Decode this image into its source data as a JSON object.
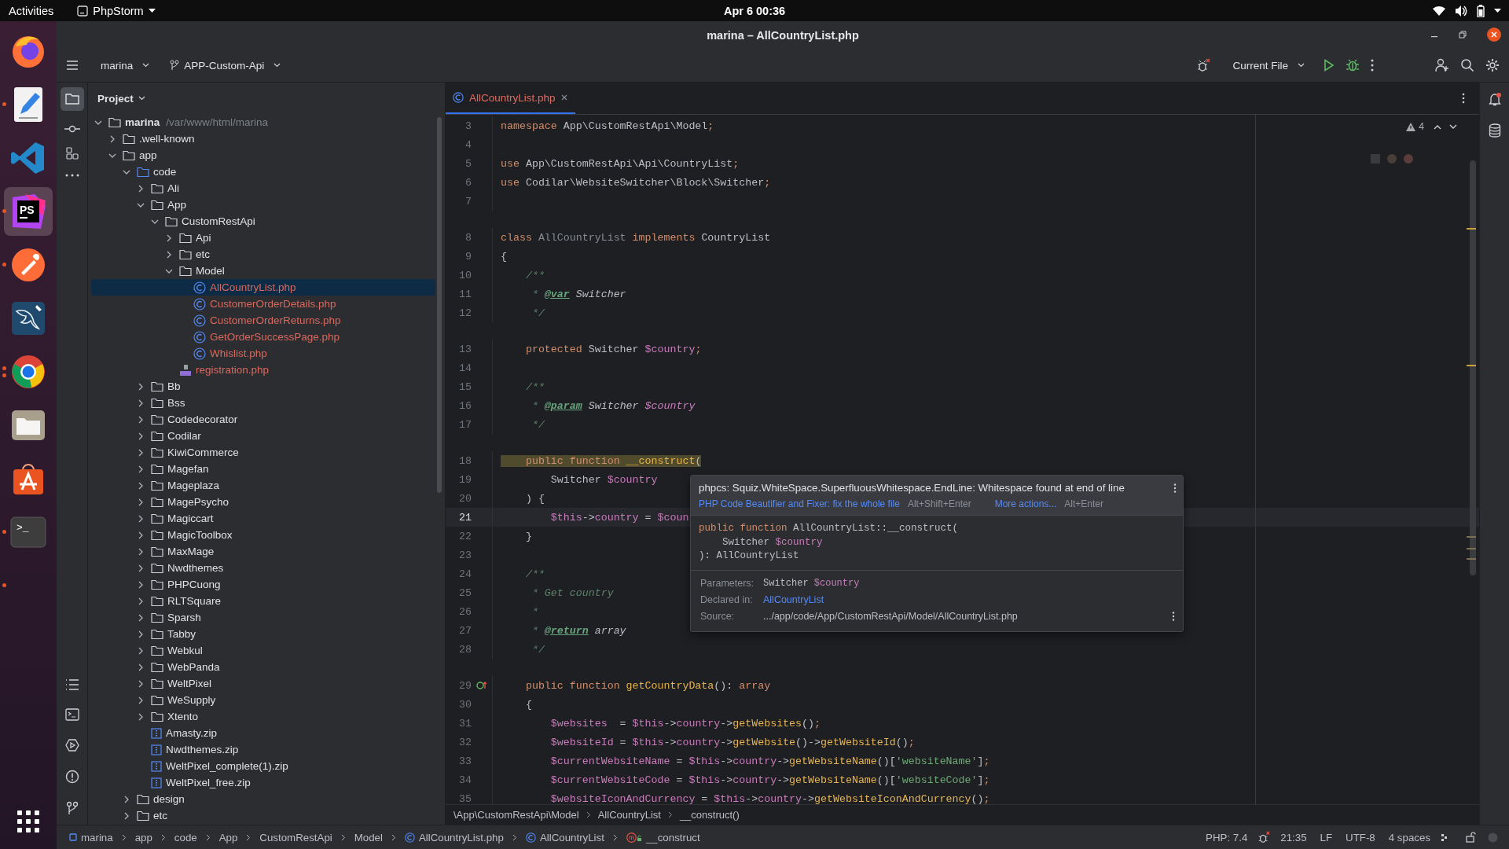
{
  "top_bar": {
    "activities": "Activities",
    "app_menu": "PhpStorm",
    "clock": "Apr 6  00:36"
  },
  "dock": [
    {
      "kind": "firefox",
      "running": false,
      "selected": false
    },
    {
      "kind": "text-editor",
      "running": true,
      "selected": false
    },
    {
      "kind": "vscode",
      "running": false,
      "selected": false
    },
    {
      "kind": "phpstorm",
      "label": "PS",
      "running": true,
      "selected": true
    },
    {
      "kind": "postman",
      "running": true,
      "selected": false
    },
    {
      "kind": "mysql",
      "running": false,
      "selected": false
    },
    {
      "kind": "chrome",
      "running": true,
      "multi": true,
      "selected": false
    },
    {
      "kind": "files",
      "running": false,
      "selected": false
    },
    {
      "kind": "store",
      "running": false,
      "selected": false
    },
    {
      "kind": "terminal",
      "label": ">_",
      "running": true,
      "selected": false
    },
    {
      "kind": "blank",
      "running": true,
      "selected": false
    }
  ],
  "window": {
    "title": "marina – AllCountryList.php"
  },
  "toolbar": {
    "project": "marina",
    "branch": "APP-Custom-Api",
    "run_config": "Current File"
  },
  "project_panel": {
    "title": "Project",
    "tree": [
      {
        "name": "marina",
        "path": "/var/www/html/marina",
        "kind": "folder",
        "expanded": true,
        "selected": false,
        "children": [
          {
            "name": ".well-known",
            "kind": "folder",
            "expanded": false,
            "selected": false
          },
          {
            "name": "app",
            "kind": "folder",
            "expanded": true,
            "selected": false,
            "children": [
              {
                "name": "code",
                "kind": "source",
                "expanded": true,
                "selected": false,
                "children": [
                  {
                    "name": "Ali",
                    "kind": "folder",
                    "expanded": false,
                    "selected": false
                  },
                  {
                    "name": "App",
                    "kind": "folder",
                    "expanded": true,
                    "selected": false,
                    "children": [
                      {
                        "name": "CustomRestApi",
                        "kind": "folder",
                        "expanded": true,
                        "selected": false,
                        "children": [
                          {
                            "name": "Api",
                            "kind": "folder",
                            "expanded": false,
                            "selected": false
                          },
                          {
                            "name": "etc",
                            "kind": "folder",
                            "expanded": false,
                            "selected": false
                          },
                          {
                            "name": "Model",
                            "kind": "folder",
                            "expanded": true,
                            "selected": false,
                            "children": [
                              {
                                "name": "AllCountryList.php",
                                "kind": "class",
                                "selected": true,
                                "color": "#d9695f"
                              },
                              {
                                "name": "CustomerOrderDetails.php",
                                "kind": "class",
                                "selected": false,
                                "color": "#d9695f"
                              },
                              {
                                "name": "CustomerOrderReturns.php",
                                "kind": "class",
                                "selected": false,
                                "color": "#d9695f"
                              },
                              {
                                "name": "GetOrderSuccessPage.php",
                                "kind": "class",
                                "selected": false,
                                "color": "#d9695f"
                              },
                              {
                                "name": "Whislist.php",
                                "kind": "class",
                                "selected": false,
                                "color": "#d9695f"
                              }
                            ]
                          },
                          {
                            "name": "registration.php",
                            "kind": "php",
                            "selected": false,
                            "color": "#d9695f"
                          }
                        ]
                      }
                    ]
                  },
                  {
                    "name": "Bb",
                    "kind": "folder",
                    "expanded": false,
                    "selected": false
                  },
                  {
                    "name": "Bss",
                    "kind": "folder",
                    "expanded": false,
                    "selected": false
                  },
                  {
                    "name": "Codedecorator",
                    "kind": "folder",
                    "expanded": false,
                    "selected": false
                  },
                  {
                    "name": "Codilar",
                    "kind": "folder",
                    "expanded": false,
                    "selected": false
                  },
                  {
                    "name": "KiwiCommerce",
                    "kind": "folder",
                    "expanded": false,
                    "selected": false
                  },
                  {
                    "name": "Magefan",
                    "kind": "folder",
                    "expanded": false,
                    "selected": false
                  },
                  {
                    "name": "Mageplaza",
                    "kind": "folder",
                    "expanded": false,
                    "selected": false
                  },
                  {
                    "name": "MagePsycho",
                    "kind": "folder",
                    "expanded": false,
                    "selected": false
                  },
                  {
                    "name": "Magiccart",
                    "kind": "folder",
                    "expanded": false,
                    "selected": false
                  },
                  {
                    "name": "MagicToolbox",
                    "kind": "folder",
                    "expanded": false,
                    "selected": false
                  },
                  {
                    "name": "MaxMage",
                    "kind": "folder",
                    "expanded": false,
                    "selected": false
                  },
                  {
                    "name": "Nwdthemes",
                    "kind": "folder",
                    "expanded": false,
                    "selected": false
                  },
                  {
                    "name": "PHPCuong",
                    "kind": "folder",
                    "expanded": false,
                    "selected": false
                  },
                  {
                    "name": "RLTSquare",
                    "kind": "folder",
                    "expanded": false,
                    "selected": false
                  },
                  {
                    "name": "Sparsh",
                    "kind": "folder",
                    "expanded": false,
                    "selected": false
                  },
                  {
                    "name": "Tabby",
                    "kind": "folder",
                    "expanded": false,
                    "selected": false
                  },
                  {
                    "name": "Webkul",
                    "kind": "folder",
                    "expanded": false,
                    "selected": false
                  },
                  {
                    "name": "WebPanda",
                    "kind": "folder",
                    "expanded": false,
                    "selected": false
                  },
                  {
                    "name": "WeltPixel",
                    "kind": "folder",
                    "expanded": false,
                    "selected": false
                  },
                  {
                    "name": "WeSupply",
                    "kind": "folder",
                    "expanded": false,
                    "selected": false
                  },
                  {
                    "name": "Xtento",
                    "kind": "folder",
                    "expanded": false,
                    "selected": false
                  },
                  {
                    "name": "Amasty.zip",
                    "kind": "zip",
                    "selected": false
                  },
                  {
                    "name": "Nwdthemes.zip",
                    "kind": "zip",
                    "selected": false
                  },
                  {
                    "name": "WeltPixel_complete(1).zip",
                    "kind": "zip",
                    "selected": false
                  },
                  {
                    "name": "WeltPixel_free.zip",
                    "kind": "zip",
                    "selected": false
                  }
                ]
              },
              {
                "name": "design",
                "kind": "folder",
                "expanded": false,
                "selected": false
              },
              {
                "name": "etc",
                "kind": "folder",
                "expanded": false,
                "selected": false
              }
            ]
          }
        ]
      }
    ]
  },
  "editor": {
    "tabs": [
      {
        "label": "AllCountryList.php",
        "selected": true
      }
    ],
    "problems": "4",
    "lines": [
      {
        "n": "3",
        "kind": "plain",
        "current": false,
        "marked": false,
        "tokens": [
          {
            "kind": "kw",
            "text": "namespace "
          },
          {
            "kind": "p",
            "text": "App\\CustomRestApi\\Model"
          },
          {
            "kind": "kw",
            "text": ";"
          }
        ]
      },
      {
        "n": "4",
        "kind": "plain",
        "current": false,
        "marked": false
      },
      {
        "n": "5",
        "kind": "plain",
        "current": false,
        "marked": false,
        "tokens": [
          {
            "kind": "kw",
            "text": "use "
          },
          {
            "kind": "p",
            "text": "App\\CustomRestApi\\Api\\CountryList"
          },
          {
            "kind": "kw",
            "text": ";"
          }
        ]
      },
      {
        "n": "6",
        "kind": "plain",
        "current": false,
        "marked": false,
        "tokens": [
          {
            "kind": "kw",
            "text": "use "
          },
          {
            "kind": "p",
            "text": "Codilar\\WebsiteSwitcher\\Block\\Switcher"
          },
          {
            "kind": "kw",
            "text": ";"
          }
        ]
      },
      {
        "n": "7",
        "kind": "plain",
        "current": false,
        "marked": false
      },
      {
        "n": "8",
        "kind": "spaced",
        "current": false,
        "marked": false,
        "tokens": [
          {
            "kind": "kw",
            "text": "class "
          },
          {
            "kind": "g",
            "text": "AllCountryList "
          },
          {
            "kind": "kw",
            "text": "implements "
          },
          {
            "kind": "p",
            "text": "CountryList"
          }
        ]
      },
      {
        "n": "9",
        "kind": "plain",
        "current": false,
        "marked": false,
        "tokens": [
          {
            "kind": "p",
            "text": "{"
          }
        ]
      },
      {
        "n": "10",
        "kind": "plain",
        "current": false,
        "marked": false,
        "tokens": [
          {
            "kind": "c",
            "text": "    /**"
          }
        ]
      },
      {
        "n": "11",
        "kind": "plain",
        "current": false,
        "marked": false,
        "tokens": [
          {
            "kind": "c",
            "text": "     * "
          },
          {
            "kind": "t",
            "text": "@var"
          },
          {
            "kind": "ct",
            "text": " Switcher"
          }
        ]
      },
      {
        "n": "12",
        "kind": "plain",
        "current": false,
        "marked": false,
        "tokens": [
          {
            "kind": "c",
            "text": "     */"
          }
        ]
      },
      {
        "n": "13",
        "kind": "spaced",
        "current": false,
        "marked": false,
        "tokens": [
          {
            "kind": "kw",
            "text": "    protected "
          },
          {
            "kind": "p",
            "text": "Switcher "
          },
          {
            "kind": "v",
            "text": "$country"
          },
          {
            "kind": "kw",
            "text": ";"
          }
        ]
      },
      {
        "n": "14",
        "kind": "plain",
        "current": false,
        "marked": false
      },
      {
        "n": "15",
        "kind": "plain",
        "current": false,
        "marked": false,
        "tokens": [
          {
            "kind": "c",
            "text": "    /**"
          }
        ]
      },
      {
        "n": "16",
        "kind": "plain",
        "current": false,
        "marked": false,
        "tokens": [
          {
            "kind": "c",
            "text": "     * "
          },
          {
            "kind": "t",
            "text": "@param"
          },
          {
            "kind": "ct",
            "text": " Switcher "
          },
          {
            "kind": "cv",
            "text": "$country"
          }
        ]
      },
      {
        "n": "17",
        "kind": "plain",
        "current": false,
        "marked": false,
        "tokens": [
          {
            "kind": "c",
            "text": "     */"
          }
        ]
      },
      {
        "n": "18",
        "kind": "spaced",
        "current": false,
        "marked": true,
        "tokens": [
          {
            "kind": "kw",
            "text": "    public function "
          },
          {
            "kind": "f",
            "text": "__construct"
          },
          {
            "kind": "p",
            "text": "("
          }
        ]
      },
      {
        "n": "19",
        "kind": "plain",
        "current": false,
        "marked": false,
        "tokens": [
          {
            "kind": "p",
            "text": "        Switcher "
          },
          {
            "kind": "v",
            "text": "$country"
          }
        ]
      },
      {
        "n": "20",
        "kind": "plain",
        "current": false,
        "marked": false,
        "tokens": [
          {
            "kind": "p",
            "text": "    ) {"
          }
        ]
      },
      {
        "n": "21",
        "kind": "plain",
        "current": true,
        "marked": false,
        "tokens": [
          {
            "kind": "v",
            "text": "        $this"
          },
          {
            "kind": "p",
            "text": "->"
          },
          {
            "kind": "v",
            "text": "country"
          },
          {
            "kind": "p",
            "text": " = "
          },
          {
            "kind": "v",
            "text": "$coun"
          }
        ]
      },
      {
        "n": "22",
        "kind": "plain",
        "current": false,
        "marked": false,
        "tokens": [
          {
            "kind": "p",
            "text": "    }"
          }
        ]
      },
      {
        "n": "23",
        "kind": "plain",
        "current": false,
        "marked": false
      },
      {
        "n": "24",
        "kind": "plain",
        "current": false,
        "marked": false,
        "tokens": [
          {
            "kind": "c",
            "text": "    /**"
          }
        ]
      },
      {
        "n": "25",
        "kind": "plain",
        "current": false,
        "marked": false,
        "tokens": [
          {
            "kind": "c",
            "text": "     * Get country"
          }
        ]
      },
      {
        "n": "26",
        "kind": "plain",
        "current": false,
        "marked": false,
        "tokens": [
          {
            "kind": "c",
            "text": "     *"
          }
        ]
      },
      {
        "n": "27",
        "kind": "plain",
        "current": false,
        "marked": false,
        "tokens": [
          {
            "kind": "c",
            "text": "     * "
          },
          {
            "kind": "t",
            "text": "@return"
          },
          {
            "kind": "ct",
            "text": " array"
          }
        ]
      },
      {
        "n": "28",
        "kind": "plain",
        "current": false,
        "marked": false,
        "tokens": [
          {
            "kind": "c",
            "text": "     */"
          }
        ]
      },
      {
        "n": "29",
        "kind": "method",
        "current": false,
        "marked": false,
        "tokens": [
          {
            "kind": "kw",
            "text": "    public function "
          },
          {
            "kind": "f",
            "text": "getCountryData"
          },
          {
            "kind": "p",
            "text": "(): "
          },
          {
            "kind": "kw",
            "text": "array"
          }
        ]
      },
      {
        "n": "30",
        "kind": "plain",
        "current": false,
        "marked": false,
        "tokens": [
          {
            "kind": "p",
            "text": "    {"
          }
        ]
      },
      {
        "n": "31",
        "kind": "plain",
        "current": false,
        "marked": false,
        "tokens": [
          {
            "kind": "v",
            "text": "        $websites"
          },
          {
            "kind": "p",
            "text": "  = "
          },
          {
            "kind": "v",
            "text": "$this"
          },
          {
            "kind": "p",
            "text": "->"
          },
          {
            "kind": "v",
            "text": "country"
          },
          {
            "kind": "p",
            "text": "->"
          },
          {
            "kind": "f",
            "text": "getWebsites"
          },
          {
            "kind": "p",
            "text": "()"
          },
          {
            "kind": "kw",
            "text": ";"
          }
        ]
      },
      {
        "n": "32",
        "kind": "plain",
        "current": false,
        "marked": false,
        "tokens": [
          {
            "kind": "v",
            "text": "        $websiteId"
          },
          {
            "kind": "p",
            "text": " = "
          },
          {
            "kind": "v",
            "text": "$this"
          },
          {
            "kind": "p",
            "text": "->"
          },
          {
            "kind": "v",
            "text": "country"
          },
          {
            "kind": "p",
            "text": "->"
          },
          {
            "kind": "f",
            "text": "getWebsite"
          },
          {
            "kind": "p",
            "text": "()->"
          },
          {
            "kind": "f",
            "text": "getWebsiteId"
          },
          {
            "kind": "p",
            "text": "()"
          },
          {
            "kind": "kw",
            "text": ";"
          }
        ]
      },
      {
        "n": "33",
        "kind": "plain",
        "current": false,
        "marked": false,
        "tokens": [
          {
            "kind": "v",
            "text": "        $currentWebsiteName"
          },
          {
            "kind": "p",
            "text": " = "
          },
          {
            "kind": "v",
            "text": "$this"
          },
          {
            "kind": "p",
            "text": "->"
          },
          {
            "kind": "v",
            "text": "country"
          },
          {
            "kind": "p",
            "text": "->"
          },
          {
            "kind": "f",
            "text": "getWebsiteName"
          },
          {
            "kind": "p",
            "text": "()["
          },
          {
            "kind": "s",
            "text": "'websiteName'"
          },
          {
            "kind": "p",
            "text": "]"
          },
          {
            "kind": "kw",
            "text": ";"
          }
        ]
      },
      {
        "n": "34",
        "kind": "plain",
        "current": false,
        "marked": false,
        "tokens": [
          {
            "kind": "v",
            "text": "        $currentWebsiteCode"
          },
          {
            "kind": "p",
            "text": " = "
          },
          {
            "kind": "v",
            "text": "$this"
          },
          {
            "kind": "p",
            "text": "->"
          },
          {
            "kind": "v",
            "text": "country"
          },
          {
            "kind": "p",
            "text": "->"
          },
          {
            "kind": "f",
            "text": "getWebsiteName"
          },
          {
            "kind": "p",
            "text": "()["
          },
          {
            "kind": "s",
            "text": "'websiteCode'"
          },
          {
            "kind": "p",
            "text": "]"
          },
          {
            "kind": "kw",
            "text": ";"
          }
        ]
      },
      {
        "n": "35",
        "kind": "plain",
        "current": false,
        "marked": false,
        "tokens": [
          {
            "kind": "v",
            "text": "        $websiteIconAndCurrency"
          },
          {
            "kind": "p",
            "text": " = "
          },
          {
            "kind": "v",
            "text": "$this"
          },
          {
            "kind": "p",
            "text": "->"
          },
          {
            "kind": "v",
            "text": "country"
          },
          {
            "kind": "p",
            "text": "->"
          },
          {
            "kind": "f",
            "text": "getWebsiteIconAndCurrency"
          },
          {
            "kind": "p",
            "text": "()"
          },
          {
            "kind": "kw",
            "text": ";"
          }
        ]
      }
    ],
    "tooltip": {
      "message": "phpcs: Squiz.WhiteSpace.SuperfluousWhitespace.EndLine: Whitespace found at end of line",
      "fix": "PHP Code Beautifier and Fixer: fix the whole file",
      "fix_shortcut": "Alt+Shift+Enter",
      "more": "More actions...",
      "more_shortcut": "Alt+Enter",
      "signature": [
        [
          {
            "kind": "kw",
            "text": "public function "
          },
          {
            "kind": "p",
            "text": "AllCountryList::__construct("
          }
        ],
        [
          {
            "kind": "p",
            "text": "    Switcher "
          },
          {
            "kind": "v",
            "text": "$country"
          }
        ],
        [
          {
            "kind": "p",
            "text": "): AllCountryList"
          }
        ]
      ],
      "params_label": "Parameters:",
      "params": [
        {
          "kind": "p",
          "text": "Switcher "
        },
        {
          "kind": "v",
          "text": "$country"
        }
      ],
      "declared_label": "Declared in:",
      "declared": "AllCountryList",
      "source_label": "Source:",
      "source": ".../app/code/App/CustomRestApi/Model/AllCountryList.php"
    },
    "breadcrumb": [
      "\\App\\CustomRestApi\\Model",
      "AllCountryList",
      "__construct()"
    ]
  },
  "status_bar": {
    "path": [
      {
        "kind": "module",
        "text": "marina"
      },
      {
        "kind": "dir",
        "text": "app"
      },
      {
        "kind": "dir",
        "text": "code"
      },
      {
        "kind": "dir",
        "text": "App"
      },
      {
        "kind": "dir",
        "text": "CustomRestApi"
      },
      {
        "kind": "dir",
        "text": "Model"
      },
      {
        "kind": "class",
        "text": "AllCountryList.php"
      },
      {
        "kind": "class",
        "text": "AllCountryList"
      },
      {
        "kind": "method",
        "text": "__construct"
      }
    ],
    "php": "PHP: 7.4",
    "position": "21:35",
    "line_ending": "LF",
    "encoding": "UTF-8",
    "indent": "4 spaces"
  }
}
